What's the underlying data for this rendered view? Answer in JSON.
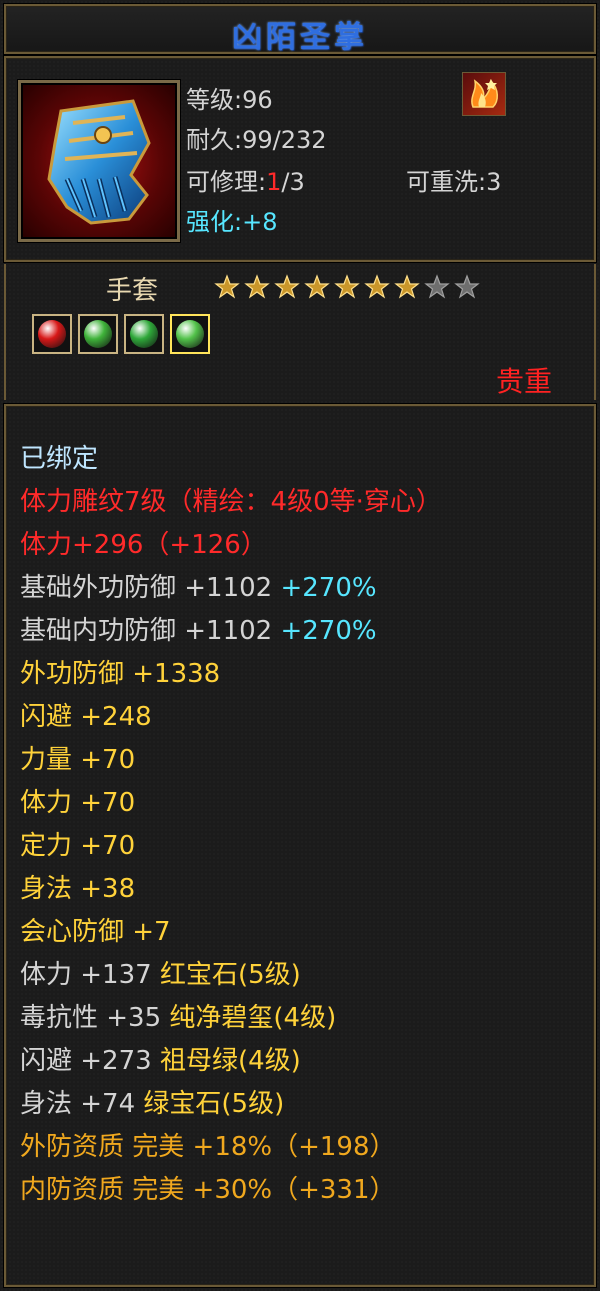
{
  "colors": {
    "white": "#d4d4d4",
    "red": "#ff2a2a",
    "yellow": "#ffd23a",
    "orange": "#f0a81e",
    "cyan": "#57e6ff",
    "bound": "#bfe6ff",
    "title": "#2f6ee0"
  },
  "item": {
    "name": "凶陌圣掌",
    "icon": "blue-gauntlet-icon",
    "badge_icon": "flame-emblem-icon",
    "level_label": "等级:",
    "level": "96",
    "durability_label": "耐久:",
    "durability": "99/232",
    "repair_label": "可修理:",
    "repair_used": "1",
    "repair_total": "/3",
    "rewash_label": "可重洗:",
    "rewash": "3",
    "enhance_label": "强化:",
    "enhance": "+8",
    "slot": "手套",
    "stars_filled": 7,
    "stars_total": 9,
    "gems": [
      {
        "icon": "red-gem-icon",
        "color": "#d81818",
        "selected": false
      },
      {
        "icon": "green-gem-icon",
        "color": "#3fb33a",
        "selected": false
      },
      {
        "icon": "green-gem-icon",
        "color": "#2fa83a",
        "selected": false
      },
      {
        "icon": "green-gem-icon",
        "color": "#52c24a",
        "selected": true
      }
    ],
    "rarity": "贵重"
  },
  "attributes": [
    {
      "color": "bound",
      "parts": [
        {
          "t": "已绑定"
        }
      ]
    },
    {
      "color": "red",
      "parts": [
        {
          "t": "体力雕纹7级（精绘：4级0等·穿心）"
        }
      ]
    },
    {
      "color": "red",
      "parts": [
        {
          "t": "体力+296（+126）"
        }
      ]
    },
    {
      "color": "white",
      "parts": [
        {
          "t": "基础外功防御 +1102 "
        },
        {
          "t": "+270%",
          "c": "cyan"
        }
      ]
    },
    {
      "color": "white",
      "parts": [
        {
          "t": "基础内功防御 +1102 "
        },
        {
          "t": "+270%",
          "c": "cyan"
        }
      ]
    },
    {
      "color": "yellow",
      "parts": [
        {
          "t": "外功防御 +1338"
        }
      ]
    },
    {
      "color": "yellow",
      "parts": [
        {
          "t": "闪避 +248"
        }
      ]
    },
    {
      "color": "yellow",
      "parts": [
        {
          "t": "力量 +70"
        }
      ]
    },
    {
      "color": "yellow",
      "parts": [
        {
          "t": "体力 +70"
        }
      ]
    },
    {
      "color": "yellow",
      "parts": [
        {
          "t": "定力 +70"
        }
      ]
    },
    {
      "color": "yellow",
      "parts": [
        {
          "t": "身法 +38"
        }
      ]
    },
    {
      "color": "yellow",
      "parts": [
        {
          "t": "会心防御 +7"
        }
      ]
    },
    {
      "color": "white",
      "parts": [
        {
          "t": "体力 +137 "
        },
        {
          "t": "红宝石(5级)",
          "c": "yellow"
        }
      ]
    },
    {
      "color": "white",
      "parts": [
        {
          "t": "毒抗性 +35 "
        },
        {
          "t": "纯净碧玺(4级)",
          "c": "yellow"
        }
      ]
    },
    {
      "color": "white",
      "parts": [
        {
          "t": "闪避 +273 "
        },
        {
          "t": "祖母绿(4级)",
          "c": "yellow"
        }
      ]
    },
    {
      "color": "white",
      "parts": [
        {
          "t": "身法 +74 "
        },
        {
          "t": "绿宝石(5级)",
          "c": "yellow"
        }
      ]
    },
    {
      "color": "orange",
      "parts": [
        {
          "t": "外防资质  完美 +18%（+198）"
        }
      ]
    },
    {
      "color": "orange",
      "parts": [
        {
          "t": "内防资质  完美 +30%（+331）"
        }
      ]
    }
  ]
}
